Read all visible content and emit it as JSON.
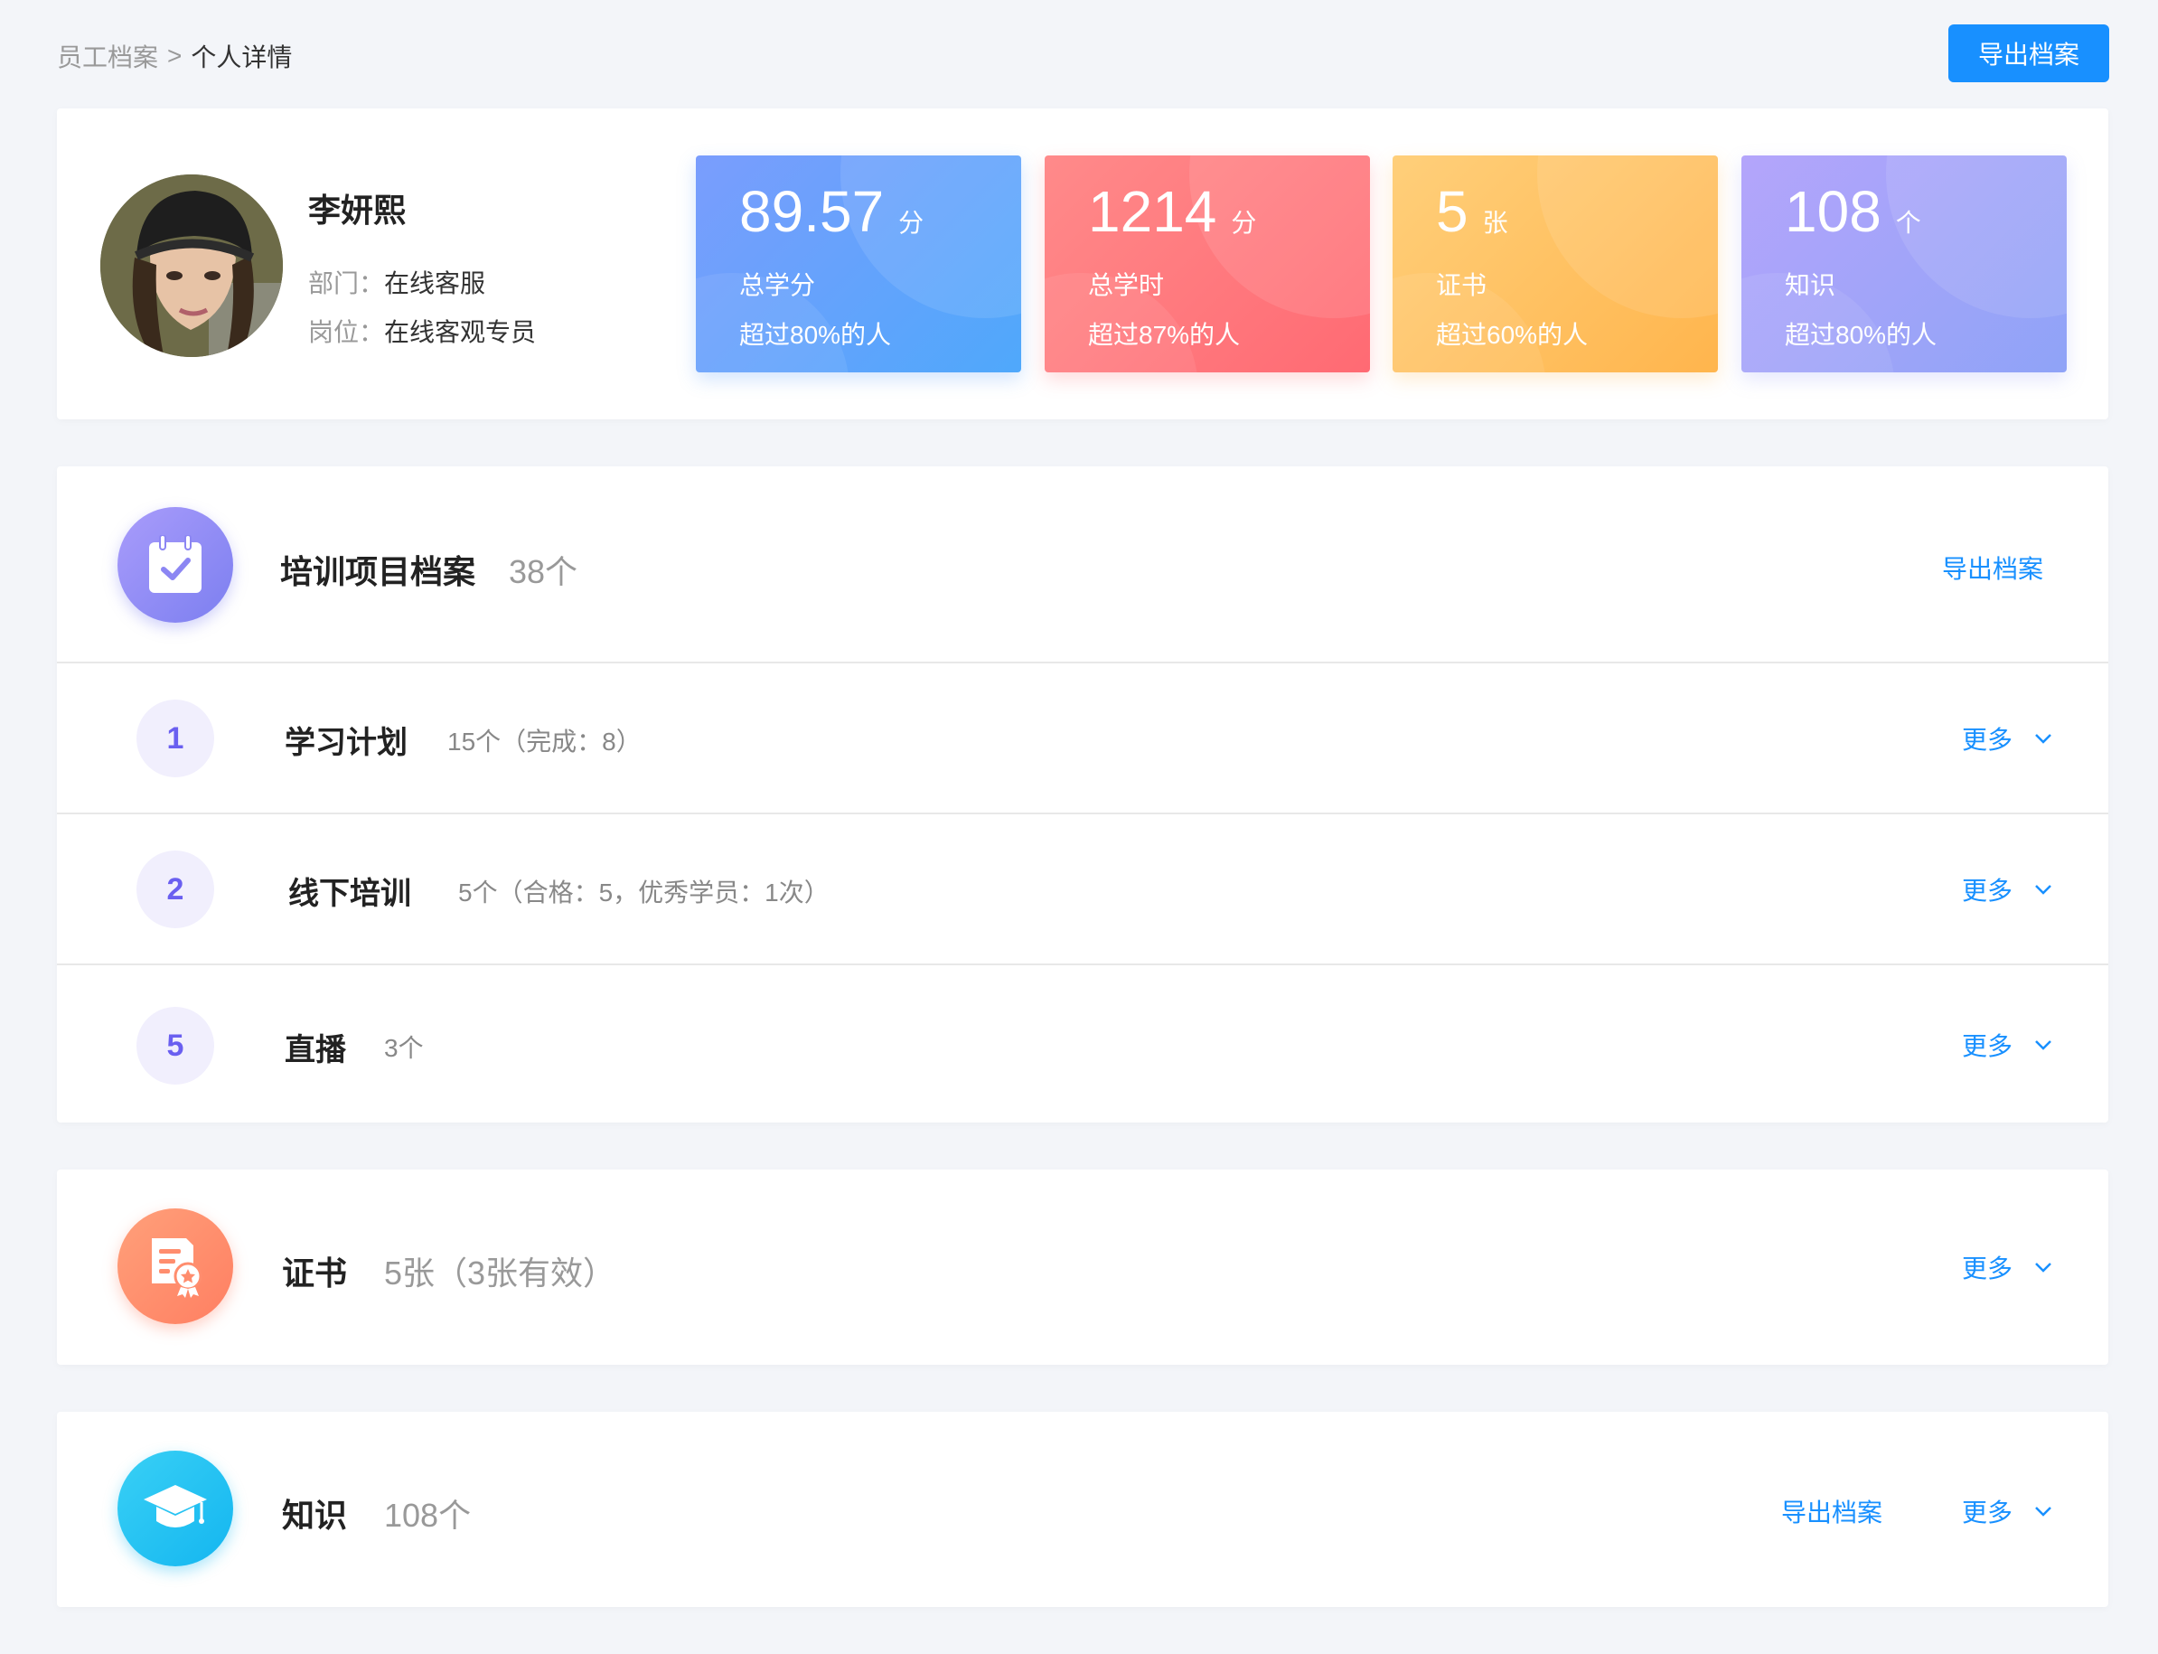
{
  "breadcrumb": {
    "parent": "员工档案",
    "separator": ">",
    "current": "个人详情"
  },
  "header": {
    "export_label": "导出档案"
  },
  "profile": {
    "name": "李妍熙",
    "dept_label": "部门：",
    "dept_value": "在线客服",
    "position_label": "岗位：",
    "position_value": "在线客观专员"
  },
  "stats": [
    {
      "value": "89.57",
      "unit": "分",
      "label": "总学分",
      "compare": "超过80%的人",
      "color": "#4fa8fb"
    },
    {
      "value": "1214",
      "unit": "分",
      "label": "总学时",
      "compare": "超过87%的人",
      "color": "#ff6a73"
    },
    {
      "value": "5",
      "unit": "张",
      "label": "证书",
      "compare": "超过60%的人",
      "color": "#ffb54d"
    },
    {
      "value": "108",
      "unit": "个",
      "label": "知识",
      "compare": "超过80%的人",
      "color": "#8fa3f7"
    }
  ],
  "training": {
    "title": "培训项目档案",
    "count": "38个",
    "export_label": "导出档案",
    "icon": "calendar-check-icon",
    "items": [
      {
        "num": "1",
        "title": "学习计划",
        "desc": "15个（完成：8）",
        "more": "更多"
      },
      {
        "num": "2",
        "title": "线下培训",
        "desc": "5个（合格：5，优秀学员：1次）",
        "more": "更多"
      },
      {
        "num": "5",
        "title": "直播",
        "desc": "3个",
        "more": "更多"
      }
    ]
  },
  "certificate": {
    "title": "证书",
    "count": "5张（3张有效）",
    "more": "更多",
    "icon": "certificate-icon"
  },
  "knowledge": {
    "title": "知识",
    "count": "108个",
    "export_label": "导出档案",
    "more": "更多",
    "icon": "graduation-cap-icon"
  },
  "colors": {
    "primary": "#1890ff",
    "badge_text": "#6a5ff0"
  }
}
